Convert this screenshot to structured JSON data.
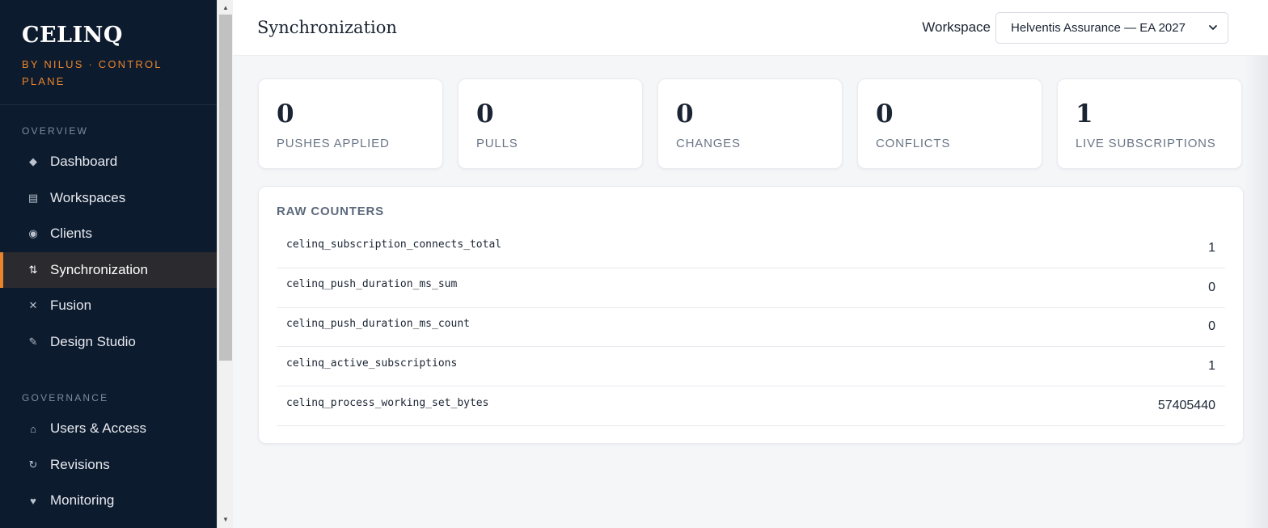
{
  "brand": {
    "name": "CELINQ",
    "subtitle": "BY NILUS · CONTROL PLANE"
  },
  "sidebar": {
    "sections": [
      {
        "label": "OVERVIEW",
        "items": [
          {
            "label": "Dashboard",
            "icon": "diamond-icon",
            "glyph": "◆"
          },
          {
            "label": "Workspaces",
            "icon": "list-icon",
            "glyph": "▤"
          },
          {
            "label": "Clients",
            "icon": "radio-icon",
            "glyph": "◉"
          },
          {
            "label": "Synchronization",
            "icon": "sync-arrows-icon",
            "glyph": "⇅",
            "active": true
          },
          {
            "label": "Fusion",
            "icon": "cross-icon",
            "glyph": "✕"
          },
          {
            "label": "Design Studio",
            "icon": "pencil-icon",
            "glyph": "✎"
          }
        ]
      },
      {
        "label": "GOVERNANCE",
        "items": [
          {
            "label": "Users & Access",
            "icon": "house-icon",
            "glyph": "⌂"
          },
          {
            "label": "Revisions",
            "icon": "refresh-icon",
            "glyph": "↻"
          },
          {
            "label": "Monitoring",
            "icon": "heart-icon",
            "glyph": "♥"
          }
        ]
      }
    ]
  },
  "header": {
    "title": "Synchronization",
    "workspace_label": "Workspace",
    "workspace_value": "Helventis Assurance — EA 2027"
  },
  "stats": [
    {
      "value": "0",
      "label": "PUSHES APPLIED"
    },
    {
      "value": "0",
      "label": "PULLS"
    },
    {
      "value": "0",
      "label": "CHANGES"
    },
    {
      "value": "0",
      "label": "CONFLICTS"
    },
    {
      "value": "1",
      "label": "LIVE SUBSCRIPTIONS"
    }
  ],
  "raw_counters": {
    "title": "RAW COUNTERS",
    "rows": [
      {
        "name": "celinq_subscription_connects_total",
        "value": "1"
      },
      {
        "name": "celinq_push_duration_ms_sum",
        "value": "0"
      },
      {
        "name": "celinq_push_duration_ms_count",
        "value": "0"
      },
      {
        "name": "celinq_active_subscriptions",
        "value": "1"
      },
      {
        "name": "celinq_process_working_set_bytes",
        "value": "57405440"
      }
    ]
  },
  "colors": {
    "sidebar_bg": "#0d1b2e",
    "accent": "#e8842c",
    "active_bg": "#2b2b2f"
  }
}
